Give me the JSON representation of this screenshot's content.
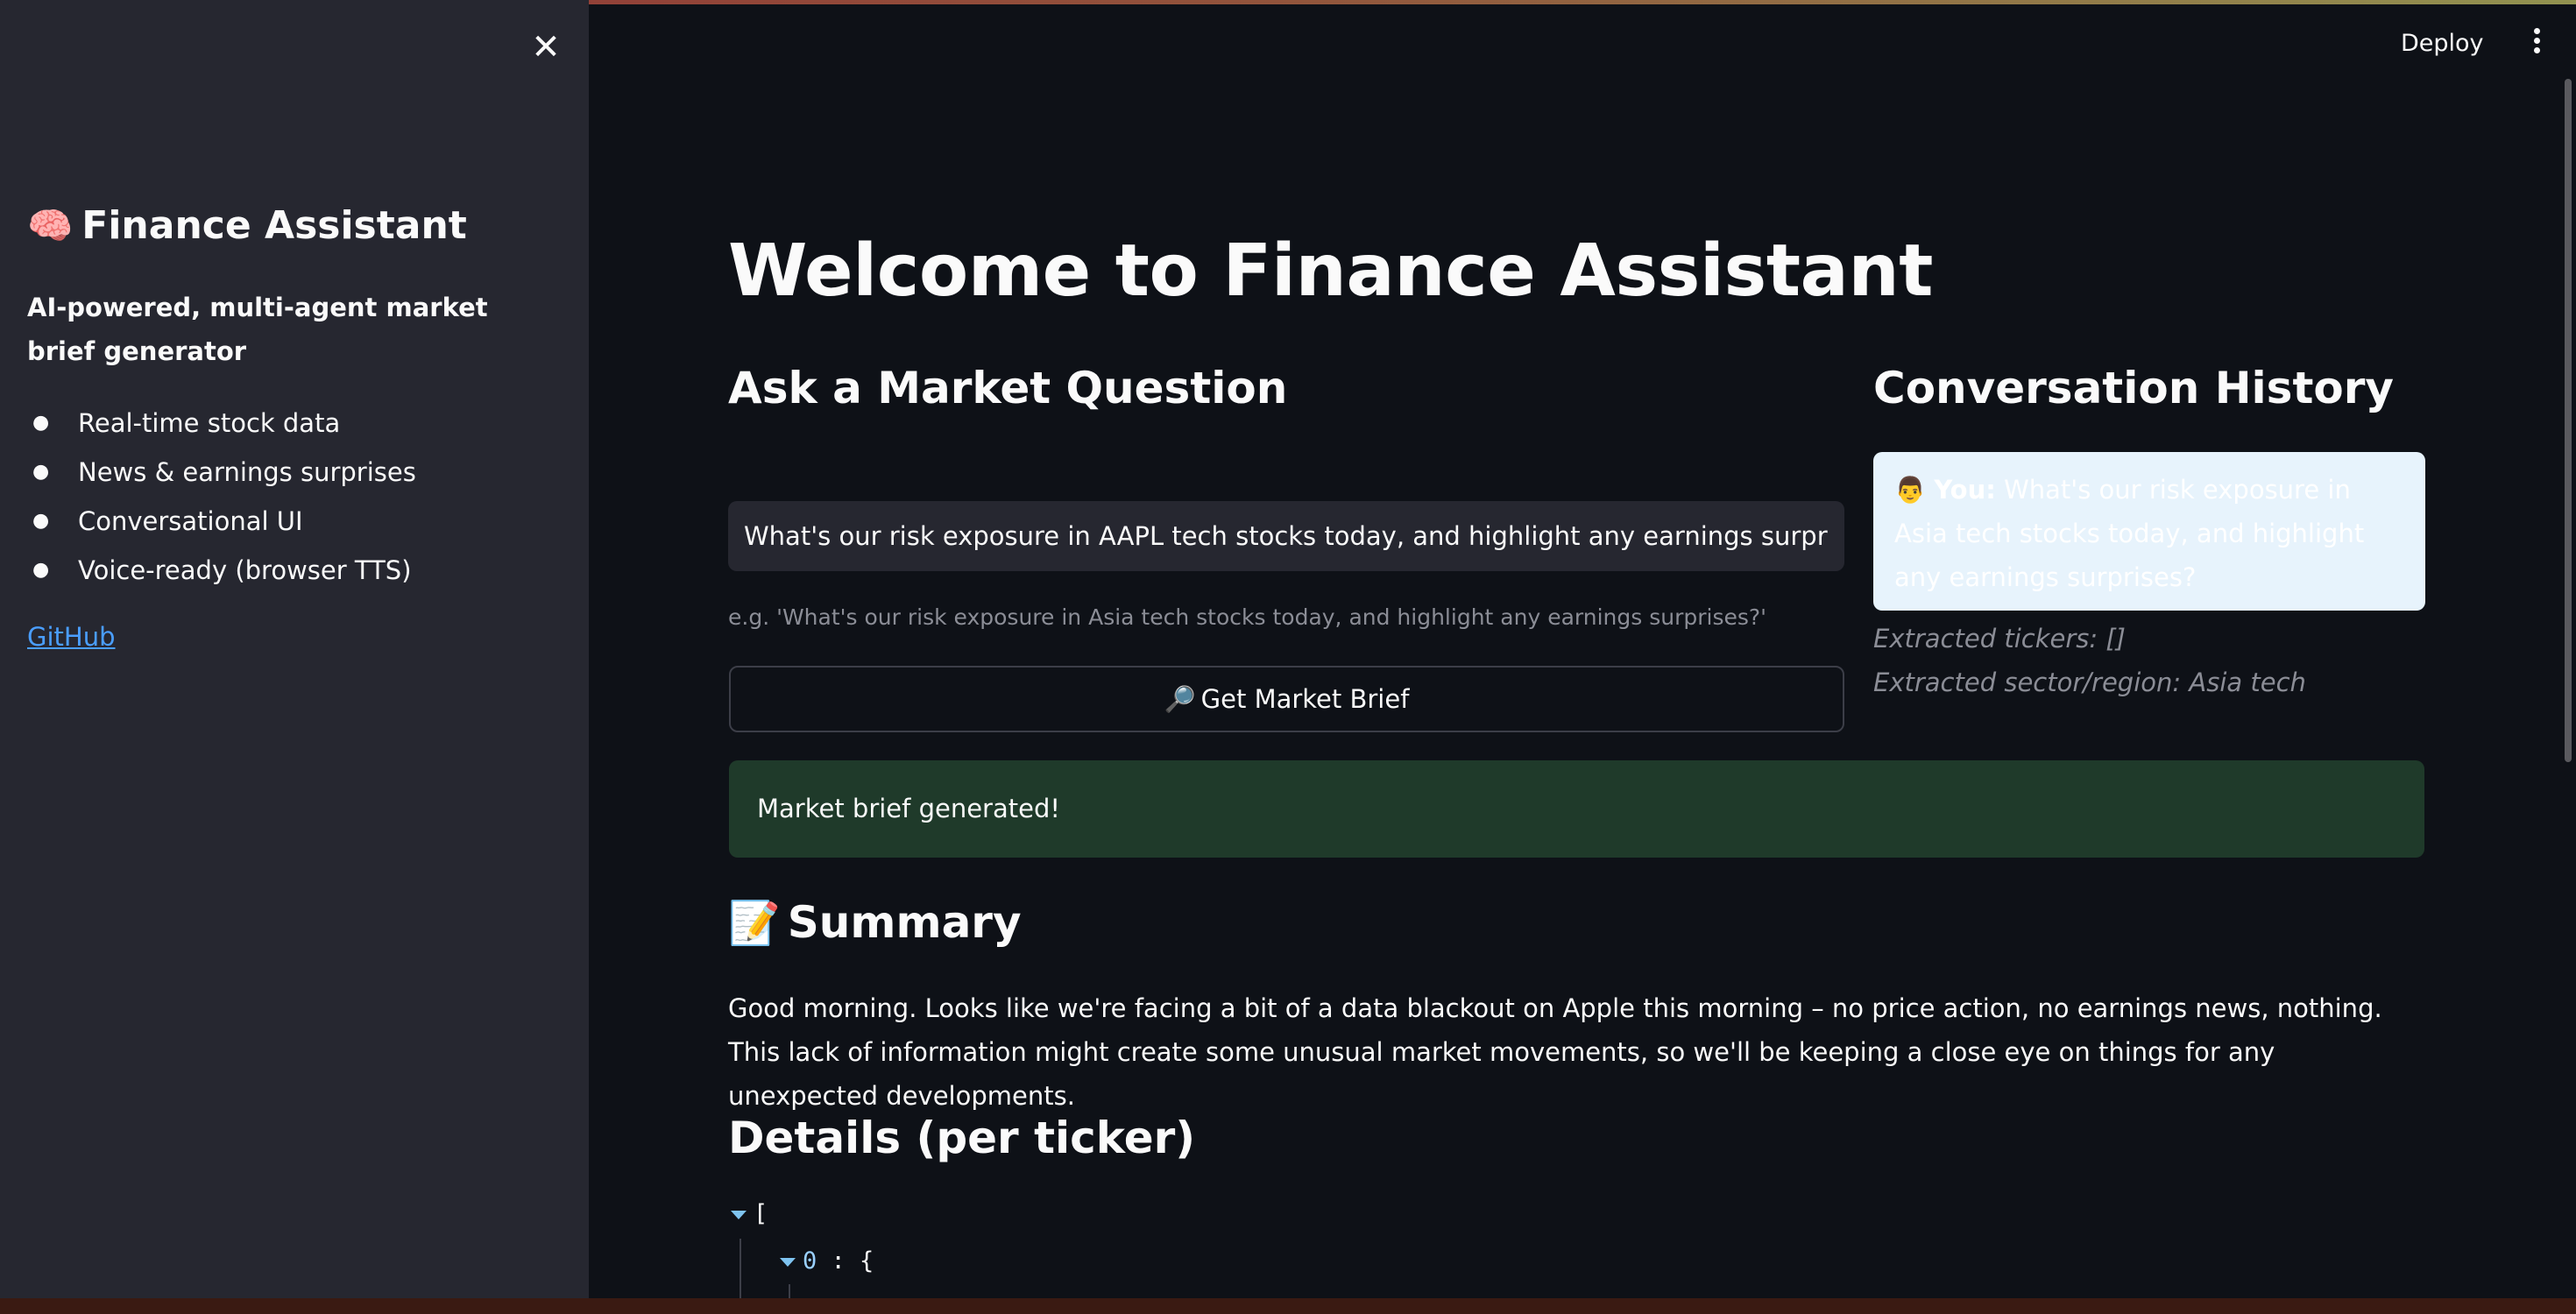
{
  "sidebar": {
    "close_glyph": "✕",
    "title_emoji": "🧠",
    "title": "Finance Assistant",
    "tagline": "AI-powered, multi-agent market brief generator",
    "features": [
      "Real-time stock data",
      "News & earnings surprises",
      "Conversational UI",
      "Voice-ready (browser TTS)"
    ],
    "link_label": "GitHub"
  },
  "header": {
    "deploy_label": "Deploy"
  },
  "main": {
    "title": "Welcome to Finance Assistant",
    "ask_heading": "Ask a Market Question",
    "question_value": "What's our risk exposure in AAPL tech stocks today, and highlight any earnings surprises?",
    "hint": "e.g. 'What's our risk exposure in Asia tech stocks today, and highlight any earnings surprises?'",
    "button_emoji": "🔎",
    "button_label": "Get Market Brief",
    "success_message": "Market brief generated!",
    "summary_emoji": "📝",
    "summary_heading": "Summary",
    "summary_text": "Good morning. Looks like we're facing a bit of a data blackout on Apple this morning – no price action, no earnings news, nothing. This lack of information might create some unusual market movements, so we'll be keeping a close eye on things for any unexpected developments.",
    "details_heading": "Details (per ticker)",
    "json_open": "[",
    "json_index": "0",
    "json_sep": " : {"
  },
  "history": {
    "heading": "Conversation History",
    "user_emoji": "👨",
    "user_label": "You:",
    "message": "What's our risk exposure in Asia tech stocks today, and highlight any earnings surprises?",
    "tickers_line": "Extracted tickers: []",
    "sector_line": "Extracted sector/region: Asia tech"
  },
  "colors": {
    "app_bg": "#0e1117",
    "sidebar_bg": "#262730",
    "success_bg": "#1f3a2a",
    "chat_bg": "#e7f3fc",
    "link": "#4a9eff"
  }
}
